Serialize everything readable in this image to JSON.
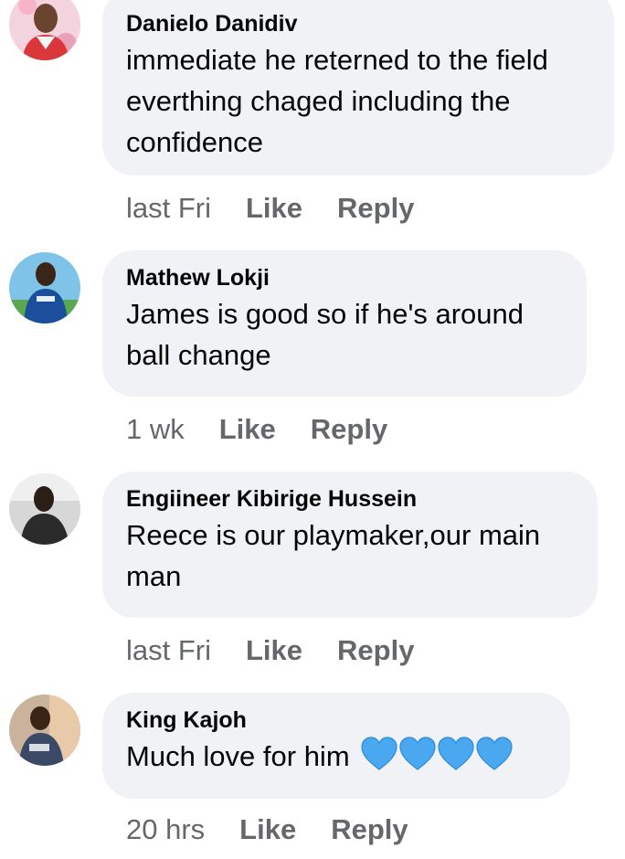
{
  "comments": [
    {
      "author": "Danielo Danidiv",
      "text_lines": [
        "immediate he reterned to the field",
        "everthing chaged including the",
        "confidence"
      ],
      "time": "last Fri",
      "like": "Like",
      "reply": "Reply",
      "avatar_icon": "user-avatar-photo"
    },
    {
      "author": "Mathew Lokji",
      "text_lines": [
        "James is good so if he's around",
        "ball change"
      ],
      "time": "1 wk",
      "like": "Like",
      "reply": "Reply",
      "avatar_icon": "user-avatar-photo"
    },
    {
      "author": "Engiineer Kibirige Hussein",
      "text_lines": [
        "Reece is our playmaker,our main",
        "man"
      ],
      "time": "last Fri",
      "like": "Like",
      "reply": "Reply",
      "avatar_icon": "user-avatar-photo"
    },
    {
      "author": "King Kajoh",
      "text": "Much love for him",
      "emoji_icons": [
        "blue-heart-icon",
        "blue-heart-icon",
        "blue-heart-icon",
        "blue-heart-icon"
      ],
      "time": "20 hrs",
      "like": "Like",
      "reply": "Reply",
      "avatar_icon": "user-avatar-photo"
    }
  ],
  "colors": {
    "bubble": "#f0f2f5",
    "text": "#050505",
    "secondary": "#65676b",
    "heart": "#4aa8f0"
  }
}
